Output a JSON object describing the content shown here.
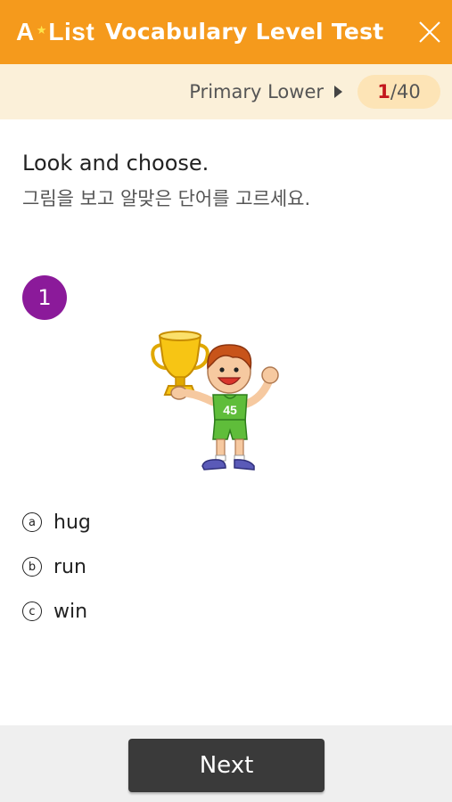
{
  "header": {
    "logo_a": "A",
    "logo_list": "List",
    "title": "Vocabulary Level Test",
    "close_icon": "close-icon"
  },
  "level": {
    "label": "Primary Lower",
    "arrow_icon": "caret-right-icon",
    "progress_current": "1",
    "progress_total": "/40"
  },
  "question": {
    "instruction_en": "Look and choose.",
    "instruction_ko": "그림을 보고 알맞은 단어를 고르세요.",
    "number": "1",
    "illustration": "boy-holding-trophy-illustration",
    "jersey_number": "45",
    "options": [
      {
        "marker": "a",
        "text": "hug"
      },
      {
        "marker": "b",
        "text": "run"
      },
      {
        "marker": "c",
        "text": "win"
      }
    ]
  },
  "footer": {
    "next_label": "Next"
  },
  "colors": {
    "header_bg": "#f59a1c",
    "level_bar_bg": "#fbf0d9",
    "progress_pill_bg": "#fde4b6",
    "progress_current": "#c3161c",
    "question_badge": "#8b1a9a",
    "next_button": "#3a3a3a",
    "footer_bg": "#efefef"
  }
}
